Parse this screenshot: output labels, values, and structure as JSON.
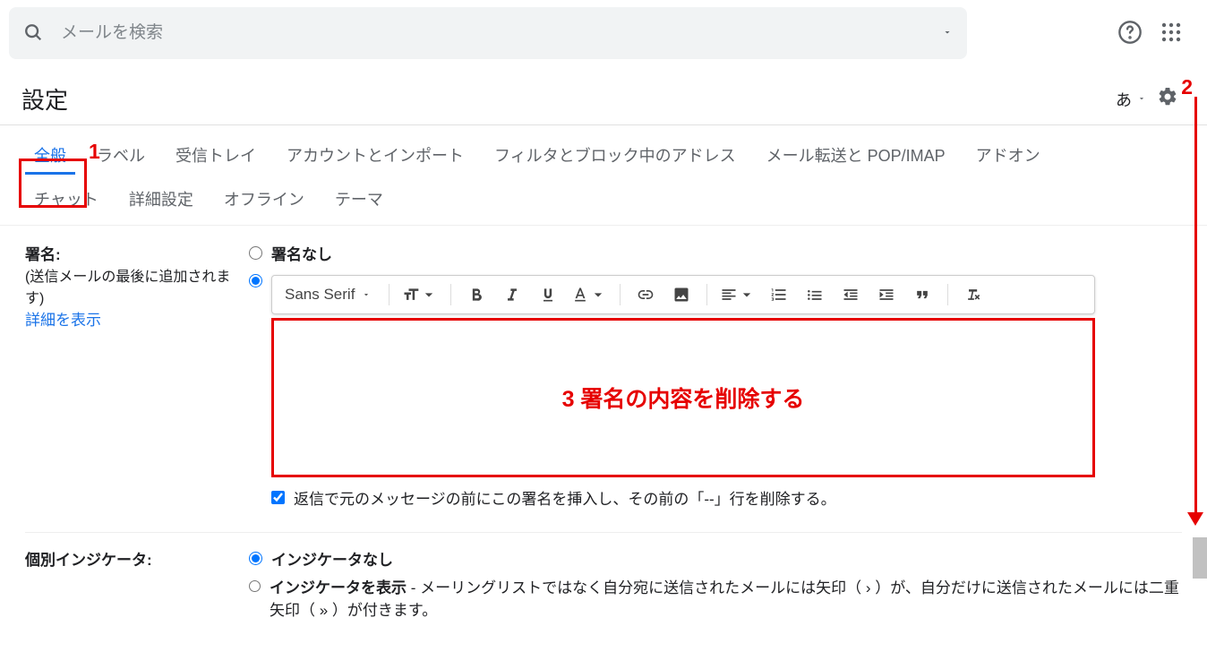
{
  "search": {
    "placeholder": "メールを検索"
  },
  "header": {
    "title": "設定",
    "lang": "あ"
  },
  "tabs": {
    "row1": [
      "全般",
      "ラベル",
      "受信トレイ",
      "アカウントとインポート",
      "フィルタとブロック中のアドレス",
      "メール転送と POP/IMAP",
      "アドオン"
    ],
    "row2": [
      "チャット",
      "詳細設定",
      "オフライン",
      "テーマ"
    ],
    "active": 0
  },
  "signature": {
    "label": "署名:",
    "sublabel": "(送信メールの最後に追加されます)",
    "details_link": "詳細を表示",
    "opt_none": "署名なし",
    "font_name": "Sans Serif",
    "checkbox_text": "返信で元のメッセージの前にこの署名を挿入し、その前の「--」行を削除する。"
  },
  "indicator": {
    "label": "個別インジケータ:",
    "opt_none": "インジケータなし",
    "opt_show": "インジケータを表示",
    "opt_show_desc": " - メーリングリストではなく自分宛に送信されたメールには矢印（ › ）が、自分だけに送信されたメールには二重矢印（ » ）が付きます。"
  },
  "annotations": {
    "n1": "1",
    "n2": "2",
    "editor_text": "3 署名の内容を削除する"
  }
}
